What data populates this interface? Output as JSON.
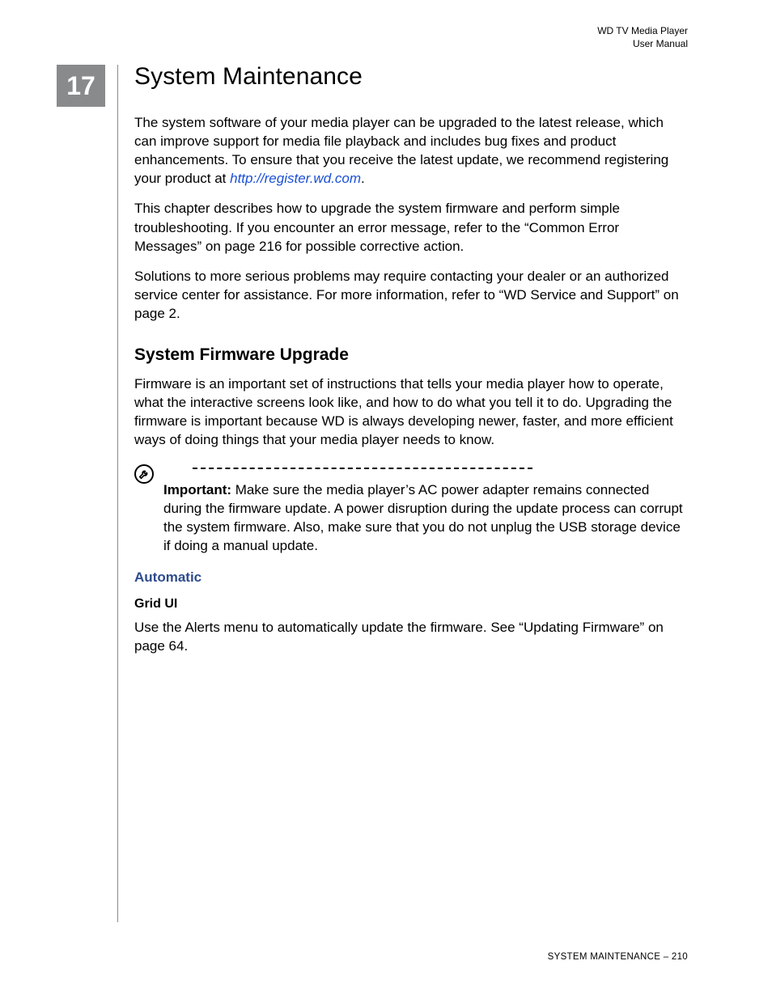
{
  "header": {
    "product_line": "WD TV Media Player",
    "doc_type": "User Manual"
  },
  "chapter_number": "17",
  "title": "System Maintenance",
  "paragraphs": {
    "intro_pre": "The system software of your media player can be upgraded to the latest release, which can improve support for media file playback and includes bug fixes and product enhancements. To ensure that you receive the latest update, we recommend registering your product at ",
    "intro_link": "http://register.wd.com",
    "intro_post": ".",
    "p2": "This chapter describes how to upgrade the system firmware and perform simple troubleshooting. If you encounter an error message, refer to the “Common Error Messages” on page 216 for possible corrective action.",
    "p3": "Solutions to more serious problems may require contacting your dealer or an authorized service center for assistance. For more information, refer to “WD Service and Support” on page 2."
  },
  "section_firmware": {
    "heading": "System Firmware Upgrade",
    "para": "Firmware is an important set of instructions that tells your media player how to operate, what the interactive screens look like, and how to do what you tell it to do. Upgrading the firmware is important because WD is always developing newer, faster, and more efficient ways of doing things that your media player needs to know."
  },
  "important": {
    "label": "Important:",
    "text": " Make sure the media player’s AC power adapter remains connected during the firmware update. A power disruption during the update process can corrupt the system firmware. Also, make sure that you do not unplug the USB storage device if doing a manual update."
  },
  "automatic": {
    "heading": "Automatic",
    "grid_heading": "Grid UI",
    "grid_para": "Use the Alerts menu to automatically update the firmware. See “Updating Firmware” on page 64."
  },
  "footer": {
    "section": "SYSTEM MAINTENANCE",
    "sep": " – ",
    "page": "210"
  }
}
